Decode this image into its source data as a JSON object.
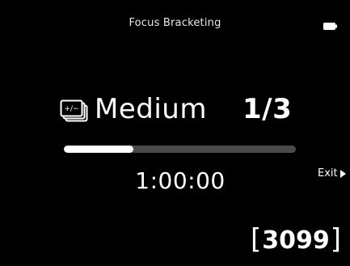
{
  "header": {
    "title": "Focus Bracketing",
    "battery_icon": "battery-icon"
  },
  "bracket": {
    "icon": "focus-bracket-icon",
    "mode": "Medium",
    "count": "1/3"
  },
  "progress": {
    "fraction": 0.3
  },
  "timer": {
    "value": "1:00:00"
  },
  "exit": {
    "label": "Exit",
    "icon": "play-arrow-icon"
  },
  "shots": {
    "open_bracket": "[",
    "value": "3099",
    "close_bracket": "]"
  },
  "colors": {
    "background": "#000000",
    "foreground": "#ffffff",
    "track": "#4a4a4a"
  }
}
